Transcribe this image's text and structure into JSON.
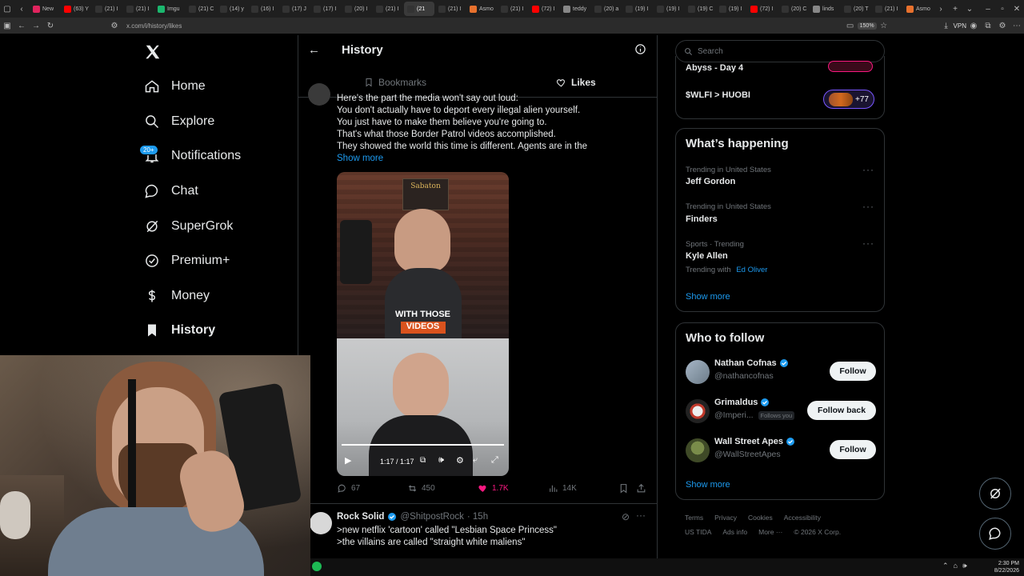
{
  "browser": {
    "tabs": [
      {
        "label": "New",
        "color": "#e0245e",
        "active": false
      },
      {
        "label": "(63) Y",
        "color": "#ff0000",
        "active": false
      },
      {
        "label": "(21) I",
        "color": "#333333",
        "active": false
      },
      {
        "label": "(21) I",
        "color": "#333333",
        "active": false
      },
      {
        "label": "Imgu",
        "color": "#1bb76e",
        "active": false
      },
      {
        "label": "(21) C",
        "color": "#333333",
        "active": false
      },
      {
        "label": "(14) y",
        "color": "#333333",
        "active": false
      },
      {
        "label": "(16) I",
        "color": "#333333",
        "active": false
      },
      {
        "label": "(17) J",
        "color": "#333333",
        "active": false
      },
      {
        "label": "(17) I",
        "color": "#333333",
        "active": false
      },
      {
        "label": "(20) I",
        "color": "#333333",
        "active": false
      },
      {
        "label": "(21) I",
        "color": "#333333",
        "active": false
      },
      {
        "label": "(21",
        "color": "#333333",
        "active": true
      },
      {
        "label": "(21) I",
        "color": "#333333",
        "active": false
      },
      {
        "label": "Asmo",
        "color": "#e8712d",
        "active": false
      },
      {
        "label": "(21) I",
        "color": "#333333",
        "active": false
      },
      {
        "label": "(72) I",
        "color": "#ff0000",
        "active": false
      },
      {
        "label": "teddy",
        "color": "#888888",
        "active": false
      },
      {
        "label": "(20) a",
        "color": "#333333",
        "active": false
      },
      {
        "label": "(19) I",
        "color": "#333333",
        "active": false
      },
      {
        "label": "(19) I",
        "color": "#333333",
        "active": false
      },
      {
        "label": "(19) C",
        "color": "#333333",
        "active": false
      },
      {
        "label": "(19) I",
        "color": "#333333",
        "active": false
      },
      {
        "label": "(72) I",
        "color": "#ff0000",
        "active": false
      },
      {
        "label": "(20) C",
        "color": "#333333",
        "active": false
      },
      {
        "label": "linds",
        "color": "#888888",
        "active": false
      },
      {
        "label": "(20) T",
        "color": "#333333",
        "active": false
      },
      {
        "label": "(21) I",
        "color": "#333333",
        "active": false
      },
      {
        "label": "Asmo",
        "color": "#e8712d",
        "active": false
      }
    ],
    "url": "x.com/i/history/likes",
    "zoom": "150%",
    "vpn_label": "VPN"
  },
  "nav": {
    "items": [
      {
        "label": "Home",
        "icon": "home-icon"
      },
      {
        "label": "Explore",
        "icon": "search-icon"
      },
      {
        "label": "Notifications",
        "icon": "bell-icon",
        "badge": "20+"
      },
      {
        "label": "Chat",
        "icon": "chat-icon"
      },
      {
        "label": "SuperGrok",
        "icon": "grok-icon"
      },
      {
        "label": "Premium+",
        "icon": "premium-icon"
      },
      {
        "label": "Money",
        "icon": "money-icon"
      },
      {
        "label": "History",
        "icon": "bookmark-icon"
      }
    ]
  },
  "center": {
    "title": "History",
    "tabs": [
      {
        "label": "Bookmarks"
      },
      {
        "label": "Likes"
      }
    ],
    "tweet1": {
      "lines": [
        "Here's the part the media won't say out loud:",
        "You don't actually have to deport every illegal alien yourself.",
        "You just have to make them believe you're going to.",
        "That's what those Border Patrol videos accomplished.",
        "They showed the world this time is different. Agents are in the"
      ],
      "show_more": "Show more",
      "caption_line1": "WITH THOSE",
      "caption_line2": "VIDEOS",
      "poster_text": "Sabaton",
      "video_time": "1:17 / 1:17",
      "video_progress": 1.0,
      "replies": "67",
      "reposts": "450",
      "likes": "1.7K",
      "views": "14K"
    },
    "tweet2": {
      "name": "Rock Solid",
      "handle": "@ShitpostRock",
      "time": "· 15h",
      "line1": ">new netflix 'cartoon' called \"Lesbian Space Princess\"",
      "line2": ">the villains are called \"straight white maliens\""
    }
  },
  "right": {
    "search_placeholder": "Search",
    "top": {
      "item1": "Abyss - Day 4",
      "item2": "$WLFI > HUOBI",
      "item2_badge": "+77"
    },
    "happening": {
      "title": "What’s happening",
      "trends": [
        {
          "meta": "Trending in United States",
          "name": "Jeff Gordon",
          "extra": ""
        },
        {
          "meta": "Trending in United States",
          "name": "Finders",
          "extra": ""
        },
        {
          "meta": "Sports · Trending",
          "name": "Kyle Allen",
          "extra_prefix": "Trending with",
          "extra": "Ed Oliver"
        }
      ],
      "show_more": "Show more"
    },
    "who_to_follow": {
      "title": "Who to follow",
      "accounts": [
        {
          "name": "Nathan Cofnas",
          "handle": "@nathancofnas",
          "button": "Follow",
          "follows_you": ""
        },
        {
          "name": "Grimaldus",
          "handle": "@Imperi...",
          "button": "Follow back",
          "follows_you": "Follows you"
        },
        {
          "name": "Wall Street Apes",
          "handle": "@WallStreetApes",
          "button": "Follow",
          "follows_you": ""
        }
      ],
      "show_more": "Show more"
    },
    "footer": {
      "row1": [
        "Terms",
        "Privacy",
        "Cookies",
        "Accessibility"
      ],
      "row2": [
        "US TIDA",
        "Ads info",
        "More ···",
        "© 2026 X Corp."
      ]
    }
  },
  "taskbar": {
    "time": "2:30 PM",
    "date": "8/22/2026"
  },
  "colors": {
    "accent": "#1d9bf0",
    "like": "#f91880",
    "border": "#2f3336",
    "muted": "#71767b"
  }
}
